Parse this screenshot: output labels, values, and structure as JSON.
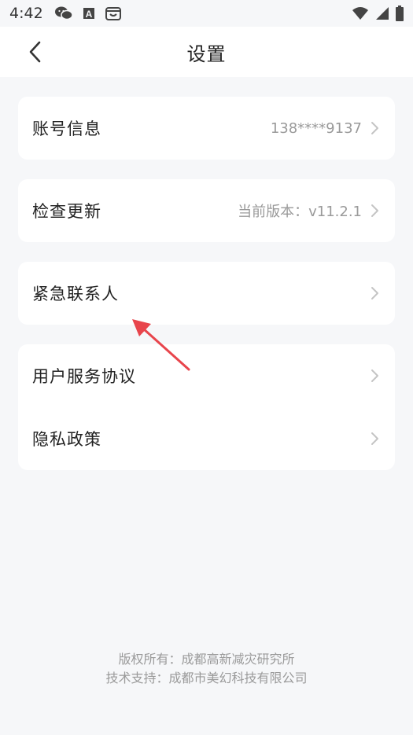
{
  "status_bar": {
    "time": "4:42",
    "icons_left": [
      "wechat-icon",
      "font-a-icon",
      "robot-icon"
    ],
    "icons_right": [
      "wifi-icon",
      "cellular-icon",
      "battery-icon"
    ]
  },
  "nav": {
    "title": "设置",
    "back_icon": "chevron-left-icon"
  },
  "settings": {
    "account": {
      "label": "账号信息",
      "value": "138****9137"
    },
    "update": {
      "label": "检查更新",
      "value": "当前版本：v11.2.1"
    },
    "emergency": {
      "label": "紧急联系人"
    },
    "agreement": {
      "label": "用户服务协议"
    },
    "privacy": {
      "label": "隐私政策"
    }
  },
  "footer": {
    "copyright": "版权所有：成都高新减灾研究所",
    "support": "技术支持：成都市美幻科技有限公司"
  },
  "colors": {
    "background": "#f6f7f9",
    "card": "#ffffff",
    "annotation_arrow": "#e8454c"
  }
}
